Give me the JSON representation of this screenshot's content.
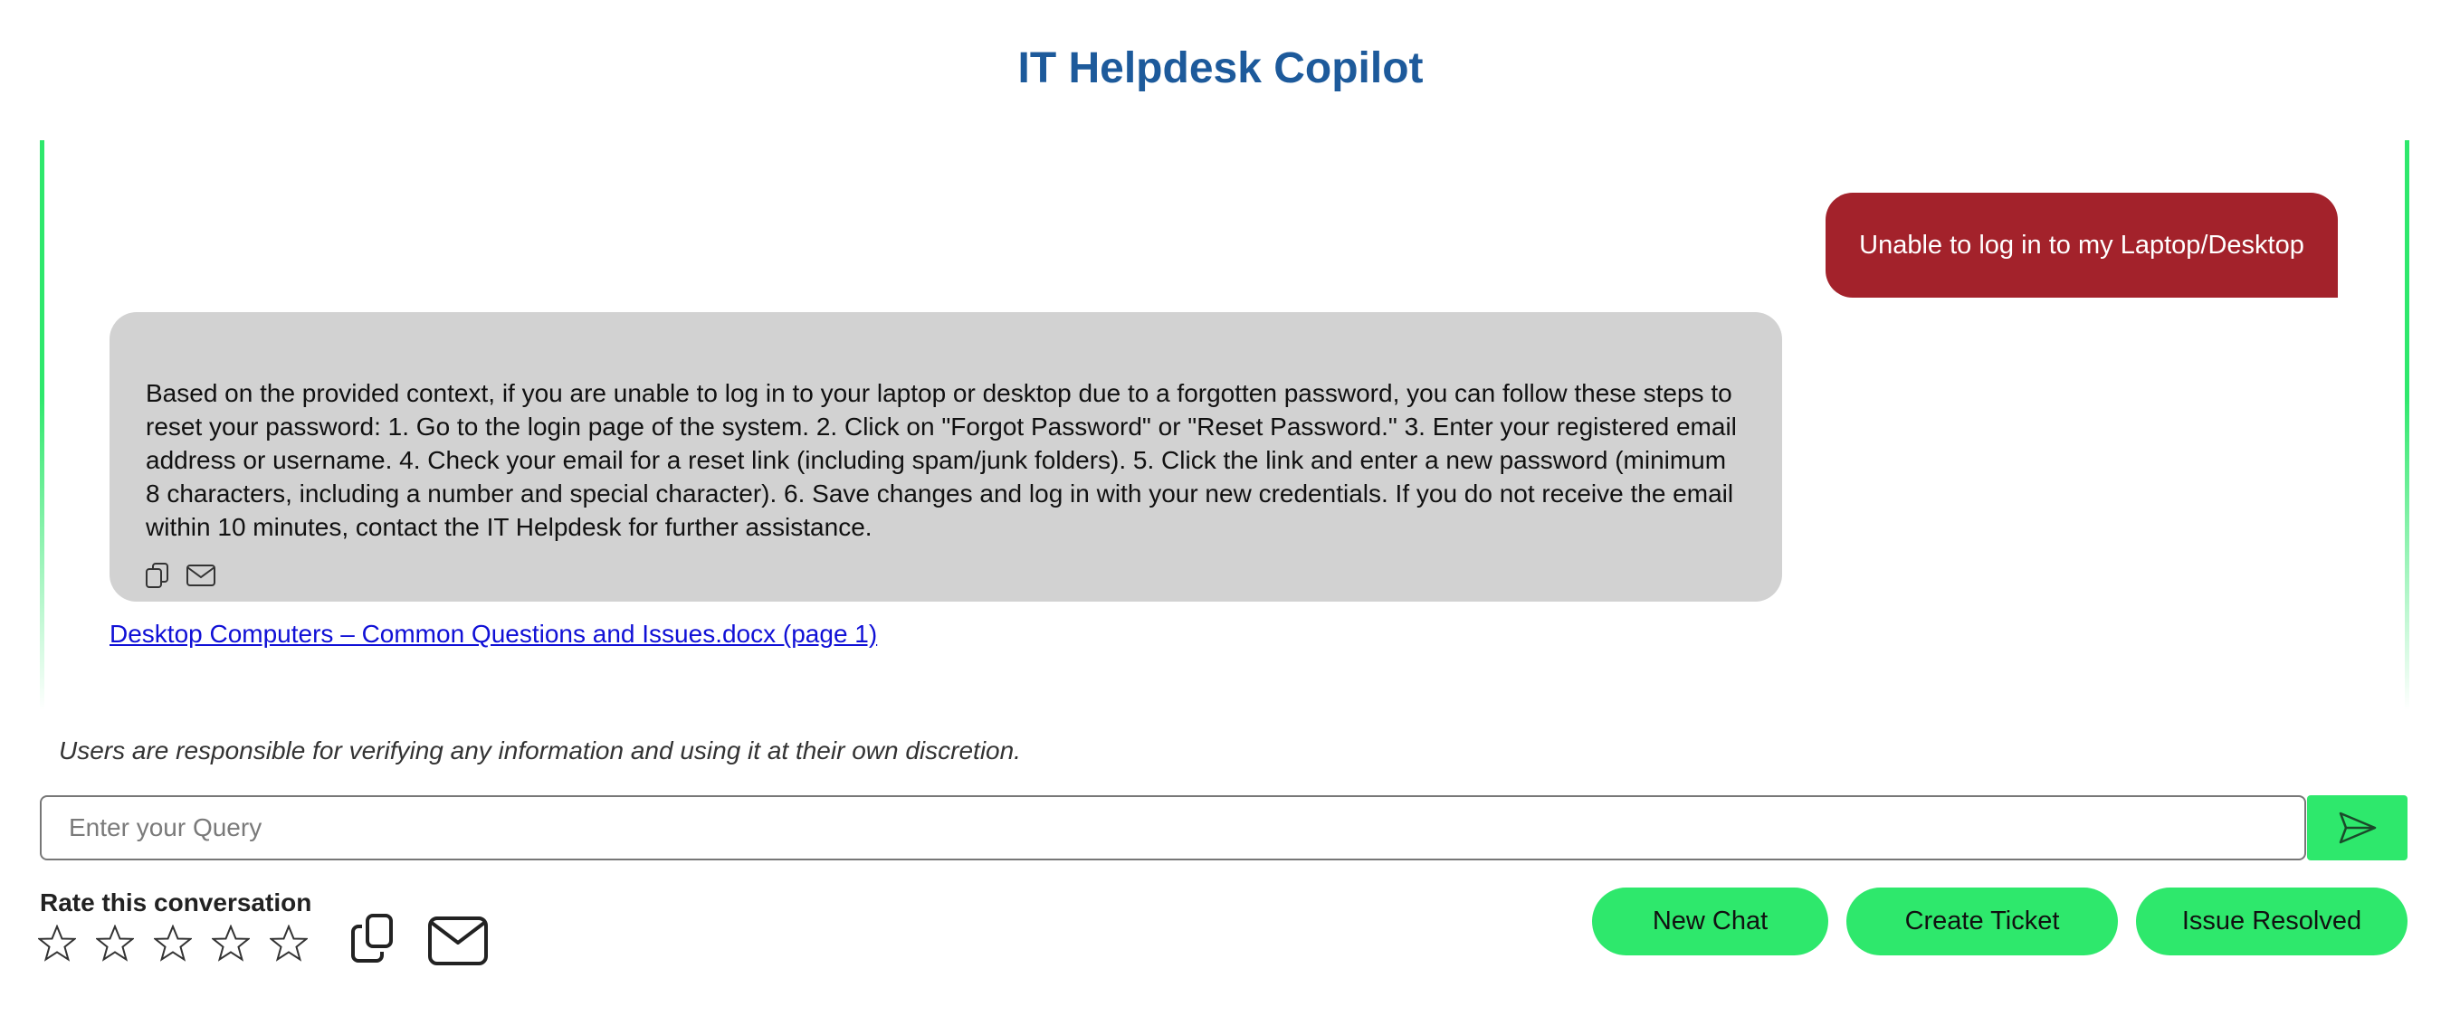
{
  "header": {
    "title": "IT Helpdesk Copilot"
  },
  "conversation": {
    "user_message": "Unable to log in to my Laptop/Desktop",
    "bot_message": "Based on the provided context, if you are unable to log in to your laptop or desktop due to a forgotten password, you can follow these steps to reset your password: 1. Go to the login page of the system. 2. Click on \"Forgot Password\" or \"Reset Password.\" 3. Enter your registered email address or username. 4. Check your email for a reset link (including spam/junk folders). 5. Click the link and enter a new password (minimum 8 characters, including a number and special character). 6. Save changes and log in with your new credentials. If you do not receive the email within 10 minutes, contact the IT Helpdesk for further assistance.",
    "bot_actions": [
      "copy-icon",
      "mail-icon"
    ],
    "source_link": "Desktop Computers – Common Questions and Issues.docx (page 1)"
  },
  "disclaimer": "Users are responsible for verifying any information and using it at their own discretion.",
  "input": {
    "placeholder": "Enter your Query",
    "value": ""
  },
  "send_icon": "send-icon",
  "rating": {
    "label": "Rate this conversation",
    "max": 5,
    "value": 0
  },
  "footer_icons": [
    "copy-icon",
    "mail-icon"
  ],
  "buttons": {
    "new_chat": "New Chat",
    "create_ticket": "Create Ticket",
    "issue_resolved": "Issue Resolved"
  },
  "colors": {
    "title": "#1d5a9b",
    "user_bubble": "#a3222b",
    "bot_bubble": "#d2d2d2",
    "accent_green": "#2ee86c",
    "link": "#1010d6"
  }
}
